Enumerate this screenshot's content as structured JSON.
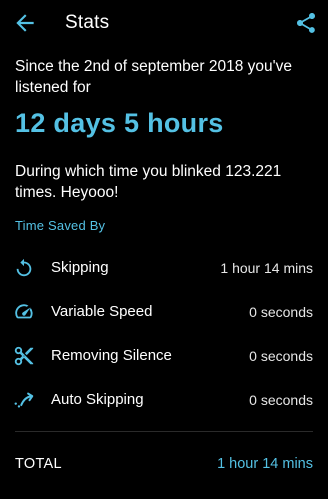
{
  "header": {
    "title": "Stats",
    "back_icon": "arrow-left-icon",
    "share_icon": "share-icon"
  },
  "colors": {
    "accent": "#54c1e4",
    "background": "#000000",
    "text": "#ffffff"
  },
  "summary": {
    "since_text": "Since the 2nd of september 2018 you've listened for",
    "listened_total": "12 days 5 hours",
    "blink_text": "During which time you blinked 123.221 times. Heyooo!"
  },
  "time_saved": {
    "section_title": "Time Saved By",
    "items": [
      {
        "icon": "refresh-icon",
        "label": "Skipping",
        "value": "1 hour 14 mins"
      },
      {
        "icon": "speedometer-icon",
        "label": "Variable Speed",
        "value": "0 seconds"
      },
      {
        "icon": "scissors-icon",
        "label": "Removing Silence",
        "value": "0 seconds"
      },
      {
        "icon": "auto-skip-icon",
        "label": "Auto Skipping",
        "value": "0 seconds"
      }
    ]
  },
  "total": {
    "label": "TOTAL",
    "value": "1 hour 14 mins"
  }
}
